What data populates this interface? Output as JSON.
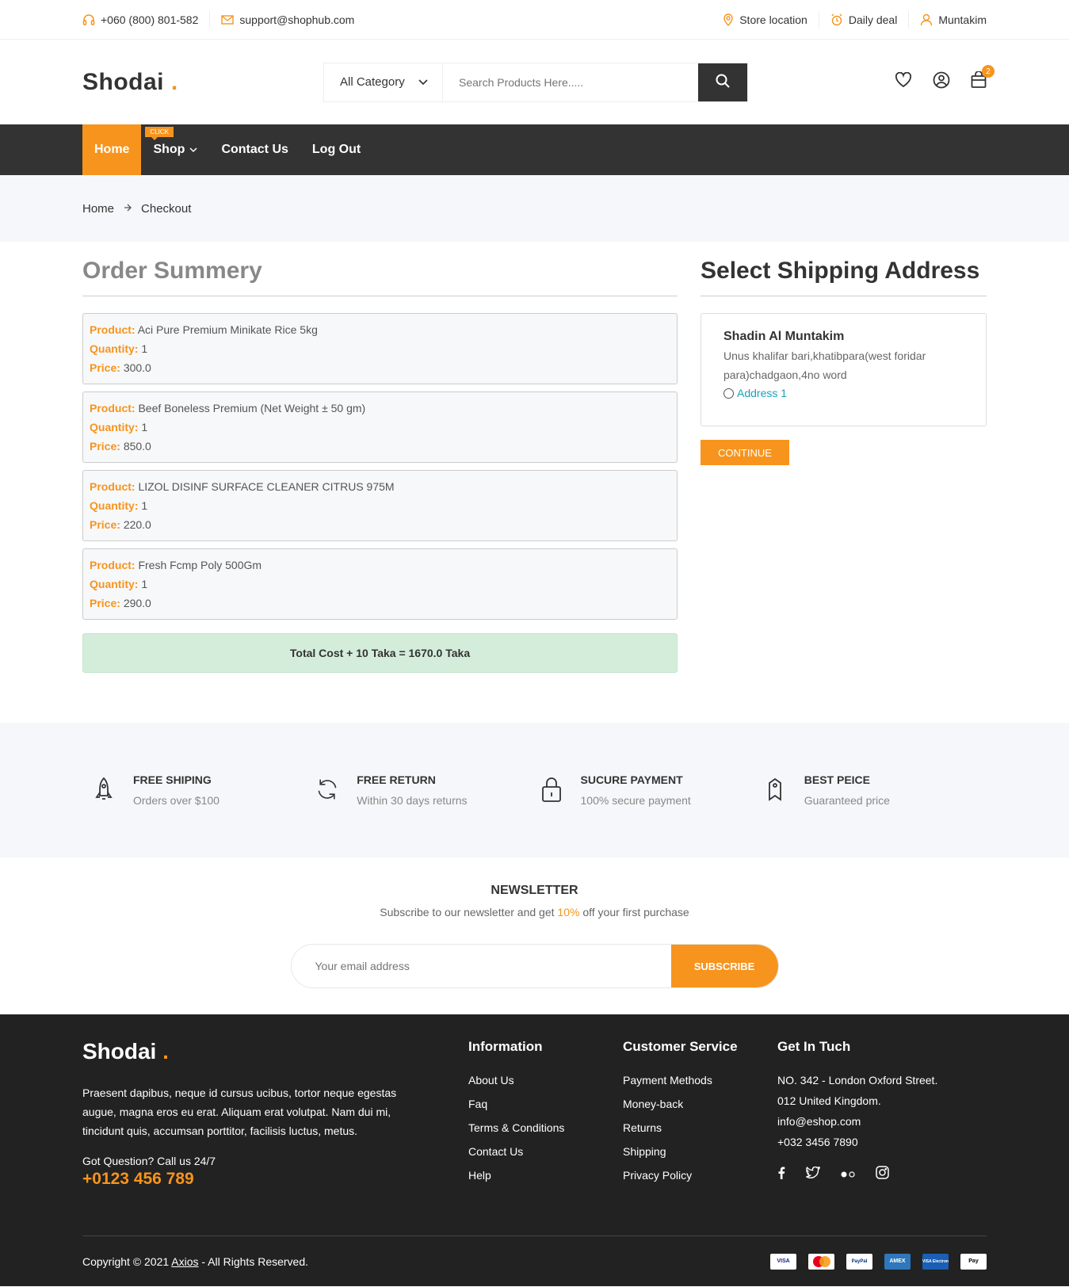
{
  "topbar": {
    "phone": "+060 (800) 801-582",
    "email": "support@shophub.com",
    "store_location": "Store location",
    "daily_deal": "Daily deal",
    "user": "Muntakim"
  },
  "header": {
    "logo": "Shodai",
    "logo_dot": ".",
    "category": "All Category",
    "search_placeholder": "Search Products Here.....",
    "cart_count": "2"
  },
  "nav": {
    "home": "Home",
    "shop": "Shop",
    "shop_tag": "CLICK",
    "contact": "Contact Us",
    "logout": "Log Out"
  },
  "breadcrumb": {
    "home": "Home",
    "current": "Checkout"
  },
  "order": {
    "title": "Order Summery",
    "product_label": "Product:",
    "quantity_label": "Quantity:",
    "price_label": "Price:",
    "items": [
      {
        "product": "Aci Pure Premium Minikate Rice 5kg",
        "quantity": "1",
        "price": "300.0"
      },
      {
        "product": "Beef Boneless Premium (Net Weight ± 50 gm)",
        "quantity": "1",
        "price": "850.0"
      },
      {
        "product": "LIZOL DISINF SURFACE CLEANER CITRUS 975M",
        "quantity": "1",
        "price": "220.0"
      },
      {
        "product": "Fresh Fcmp Poly 500Gm",
        "quantity": "1",
        "price": "290.0"
      }
    ],
    "total": "Total Cost + 10 Taka = 1670.0 Taka"
  },
  "shipping": {
    "title": "Select Shipping Address",
    "name": "Shadin Al Muntakim",
    "address": "Unus khalifar bari,khatibpara(west foridar para)chadgaon,4no word",
    "option": "Address 1",
    "continue": "CONTINUE"
  },
  "services": [
    {
      "title": "FREE SHIPING",
      "sub": "Orders over $100",
      "icon": "rocket-icon"
    },
    {
      "title": "FREE RETURN",
      "sub": "Within 30 days returns",
      "icon": "refresh-icon"
    },
    {
      "title": "SUCURE PAYMENT",
      "sub": "100% secure payment",
      "icon": "lock-icon"
    },
    {
      "title": "BEST PEICE",
      "sub": "Guaranteed price",
      "icon": "tag-icon"
    }
  ],
  "newsletter": {
    "title": "NEWSLETTER",
    "sub_before": "Subscribe to our newsletter and get ",
    "sub_pct": "10%",
    "sub_after": " off your first purchase",
    "placeholder": "Your email address",
    "button": "SUBSCRIBE"
  },
  "footer": {
    "logo": "Shodai",
    "logo_dot": ".",
    "desc": "Praesent dapibus, neque id cursus ucibus, tortor neque egestas augue, magna eros eu erat. Aliquam erat volutpat. Nam dui mi, tincidunt quis, accumsan porttitor, facilisis luctus, metus.",
    "question": "Got Question? Call us 24/7",
    "phone": "+0123 456 789",
    "info_title": "Information",
    "info_links": [
      "About Us",
      "Faq",
      "Terms & Conditions",
      "Contact Us",
      "Help"
    ],
    "cs_title": "Customer Service",
    "cs_links": [
      "Payment Methods",
      "Money-back",
      "Returns",
      "Shipping",
      "Privacy Policy"
    ],
    "contact_title": "Get In Tuch",
    "contact_lines": [
      "NO. 342 - London Oxford Street.",
      "012 United Kingdom.",
      "info@eshop.com",
      "+032 3456 7890"
    ],
    "copyright_before": "Copyright © 2021 ",
    "copyright_link": "Axios",
    "copyright_after": " - All Rights Reserved.",
    "payments": [
      "VISA",
      "mastercard",
      "PayPal",
      "AMEX",
      "VISA Electron",
      "Pay"
    ]
  },
  "colors": {
    "accent": "#f7941d",
    "dark": "#333333",
    "footer_bg": "#222222"
  }
}
